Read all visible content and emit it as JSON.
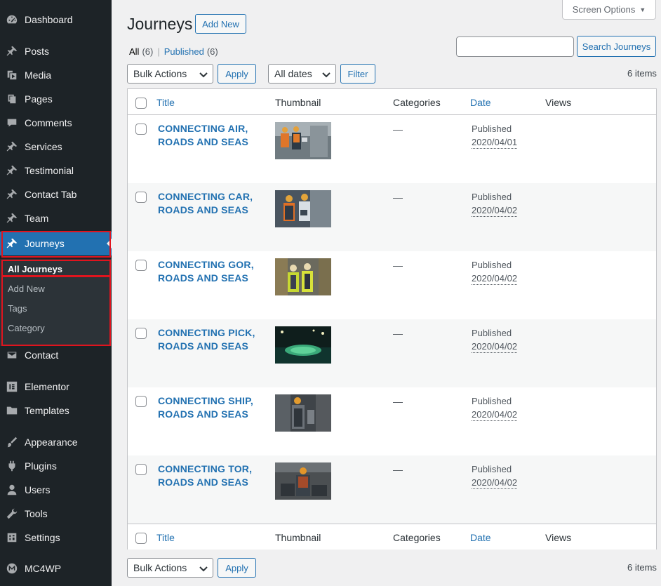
{
  "sidebar": {
    "items": [
      {
        "label": "Dashboard",
        "icon": "dashboard-icon"
      },
      {
        "label": "Posts",
        "icon": "pin-icon"
      },
      {
        "label": "Media",
        "icon": "media-icon"
      },
      {
        "label": "Pages",
        "icon": "pages-icon"
      },
      {
        "label": "Comments",
        "icon": "comments-icon"
      },
      {
        "label": "Services",
        "icon": "pin-icon"
      },
      {
        "label": "Testimonial",
        "icon": "pin-icon"
      },
      {
        "label": "Contact Tab",
        "icon": "pin-icon"
      },
      {
        "label": "Team",
        "icon": "pin-icon"
      },
      {
        "label": "Journeys",
        "icon": "pin-icon",
        "active": true
      },
      {
        "label": "Contact",
        "icon": "mail-icon"
      },
      {
        "label": "Elementor",
        "icon": "elementor-icon"
      },
      {
        "label": "Templates",
        "icon": "folder-icon"
      },
      {
        "label": "Appearance",
        "icon": "brush-icon"
      },
      {
        "label": "Plugins",
        "icon": "plugin-icon"
      },
      {
        "label": "Users",
        "icon": "users-icon"
      },
      {
        "label": "Tools",
        "icon": "wrench-icon"
      },
      {
        "label": "Settings",
        "icon": "settings-icon"
      },
      {
        "label": "MC4WP",
        "icon": "mc4wp-icon"
      }
    ],
    "submenu": [
      "All Journeys",
      "Add New",
      "Tags",
      "Category"
    ]
  },
  "header": {
    "screen_options": "Screen Options",
    "title": "Journeys",
    "add_new": "Add New"
  },
  "views": {
    "all_label": "All",
    "all_count": "(6)",
    "separator": "|",
    "published_label": "Published",
    "published_count": "(6)"
  },
  "search": {
    "button": "Search Journeys",
    "value": ""
  },
  "toolbar": {
    "bulk_actions": "Bulk Actions",
    "apply": "Apply",
    "dates": "All dates",
    "filter": "Filter",
    "items_count": "6 items"
  },
  "table": {
    "columns": [
      "Title",
      "Thumbnail",
      "Categories",
      "Date",
      "Views"
    ],
    "rows": [
      {
        "title": "CONNECTING AIR, ROADS AND SEAS",
        "categories": "—",
        "status": "Published",
        "date": "2020/04/01",
        "views": ""
      },
      {
        "title": "CONNECTING CAR, ROADS AND SEAS",
        "categories": "—",
        "status": "Published",
        "date": "2020/04/02",
        "views": ""
      },
      {
        "title": "CONNECTING GOR, ROADS AND SEAS",
        "categories": "—",
        "status": "Published",
        "date": "2020/04/02",
        "views": ""
      },
      {
        "title": "CONNECTING PICK, ROADS AND SEAS",
        "categories": "—",
        "status": "Published",
        "date": "2020/04/02",
        "views": ""
      },
      {
        "title": "CONNECTING SHIP, ROADS AND SEAS",
        "categories": "—",
        "status": "Published",
        "date": "2020/04/02",
        "views": ""
      },
      {
        "title": "CONNECTING TOR, ROADS AND SEAS",
        "categories": "—",
        "status": "Published",
        "date": "2020/04/02",
        "views": ""
      }
    ]
  },
  "colors": {
    "admin_bar": "#1d2327",
    "accent": "#2271b1",
    "highlight": "#e0141e"
  }
}
